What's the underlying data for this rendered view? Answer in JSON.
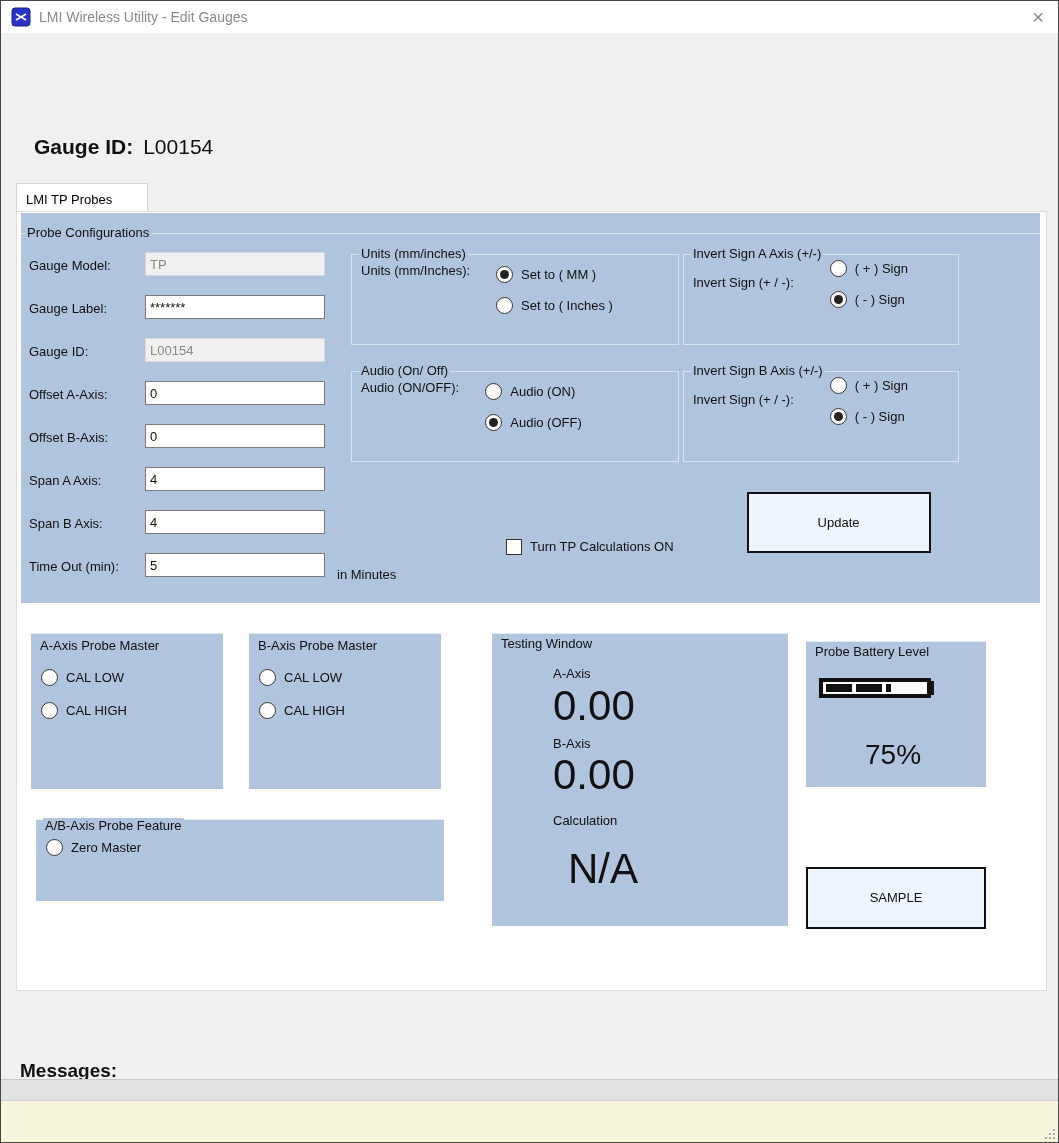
{
  "window": {
    "title": "LMI Wireless Utility - Edit Gauges",
    "close": "×"
  },
  "header": {
    "label": "Gauge ID:",
    "value": "L00154"
  },
  "tabs": [
    {
      "label": "LMI TP Probes",
      "selected": true
    }
  ],
  "probe_configurations": {
    "title": "Probe Configurations",
    "fields": [
      {
        "label": "Gauge Model:",
        "value": "TP",
        "disabled": true
      },
      {
        "label": "Gauge Label:",
        "value": "*******",
        "disabled": false
      },
      {
        "label": "Gauge ID:",
        "value": "L00154",
        "disabled": true
      },
      {
        "label": "Offset A-Axis:",
        "value": "0",
        "disabled": false
      },
      {
        "label": "Offset B-Axis:",
        "value": "0",
        "disabled": false
      },
      {
        "label": "Span A Axis:",
        "value": "4",
        "disabled": false
      },
      {
        "label": "Span B Axis:",
        "value": "4",
        "disabled": false
      },
      {
        "label": "Time Out (min):",
        "value": "5",
        "disabled": false,
        "suffix": "in Minutes"
      }
    ],
    "option_groups": [
      {
        "title": "Units (mm/inches)",
        "label": "Units (mm/Inches):",
        "options": [
          {
            "label": "Set to ( MM )",
            "selected": true
          },
          {
            "label": "Set to ( Inches )",
            "selected": false
          }
        ]
      },
      {
        "title": "Invert Sign A Axis (+/-)",
        "label": "Invert Sign (+ / -):",
        "options": [
          {
            "label": "( + ) Sign",
            "selected": false
          },
          {
            "label": "( - ) Sign",
            "selected": true
          }
        ]
      },
      {
        "title": "Audio (On/ Off)",
        "label": "Audio (ON/OFF):",
        "options": [
          {
            "label": "Audio (ON)",
            "selected": false
          },
          {
            "label": "Audio (OFF)",
            "selected": true
          }
        ]
      },
      {
        "title": "Invert Sign B Axis (+/-)",
        "label": "Invert Sign (+ / -):",
        "options": [
          {
            "label": "( + ) Sign",
            "selected": false
          },
          {
            "label": "( - ) Sign",
            "selected": true
          }
        ]
      }
    ],
    "checkbox": {
      "label": "Turn TP Calculations ON",
      "checked": false
    },
    "update_button": "Update"
  },
  "probe_masters": [
    {
      "title": "A-Axis Probe Master",
      "options": [
        {
          "label": "CAL LOW",
          "selected": false
        },
        {
          "label": "CAL HIGH",
          "selected": false
        }
      ]
    },
    {
      "title": "B-Axis Probe Master",
      "options": [
        {
          "label": "CAL LOW",
          "selected": false
        },
        {
          "label": "CAL HIGH",
          "selected": false
        }
      ]
    }
  ],
  "probe_feature": {
    "title": "A/B-Axis Probe Feature",
    "options": [
      {
        "label": "Zero Master",
        "selected": false
      }
    ]
  },
  "testing_window": {
    "title": "Testing Window",
    "readings": [
      {
        "label": "A-Axis",
        "value": "0.00"
      },
      {
        "label": "B-Axis",
        "value": "0.00"
      },
      {
        "label": "Calculation",
        "value": "N/A"
      }
    ]
  },
  "battery": {
    "title": "Probe Battery Level",
    "reading": "75%"
  },
  "sample_button": "SAMPLE",
  "messages": {
    "label": "Messages:"
  }
}
